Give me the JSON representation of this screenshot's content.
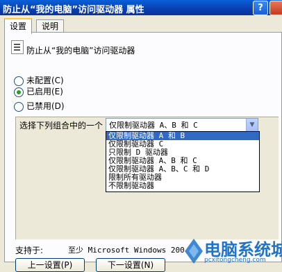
{
  "window": {
    "title": "防止从“我的电脑”访问驱动器 属性",
    "help_glyph": "?"
  },
  "tabs": [
    {
      "label": "设置",
      "active": true
    },
    {
      "label": "说明",
      "active": false
    }
  ],
  "policy": {
    "icon": "policy-document-icon",
    "name": "防止从“我的电脑”访问驱动器"
  },
  "radios": [
    {
      "label": "未配置(C)",
      "checked": false
    },
    {
      "label": "已启用(E)",
      "checked": true
    },
    {
      "label": "已禁用(D)",
      "checked": false
    }
  ],
  "option": {
    "label": "选择下列组合中的一个",
    "selected": "仅限制驱动器 A、B 和 C",
    "dropdown_items": [
      "仅限制驱动器 A 和 B",
      "仅限制驱动器 C",
      "只限制 D 驱动器",
      "仅限制驱动器 A、B 和 C",
      "仅限制驱动器 A、B、C 和 D",
      "限制所有驱动器",
      "不限制驱动器"
    ],
    "highlighted_index": 0
  },
  "support": {
    "label": "支持于:",
    "value": "至少 Microsoft Windows 200"
  },
  "buttons": {
    "prev": "上一设置(P)",
    "next": "下一设置(N)"
  },
  "watermark": {
    "text": "电脑系统城",
    "url": "pcxitongcheng.com"
  },
  "colors": {
    "titlebar": "#0a5fd8",
    "dialog_bg": "#ece9d8",
    "selection": "#316ac5",
    "watermark": "#1f73c8"
  }
}
